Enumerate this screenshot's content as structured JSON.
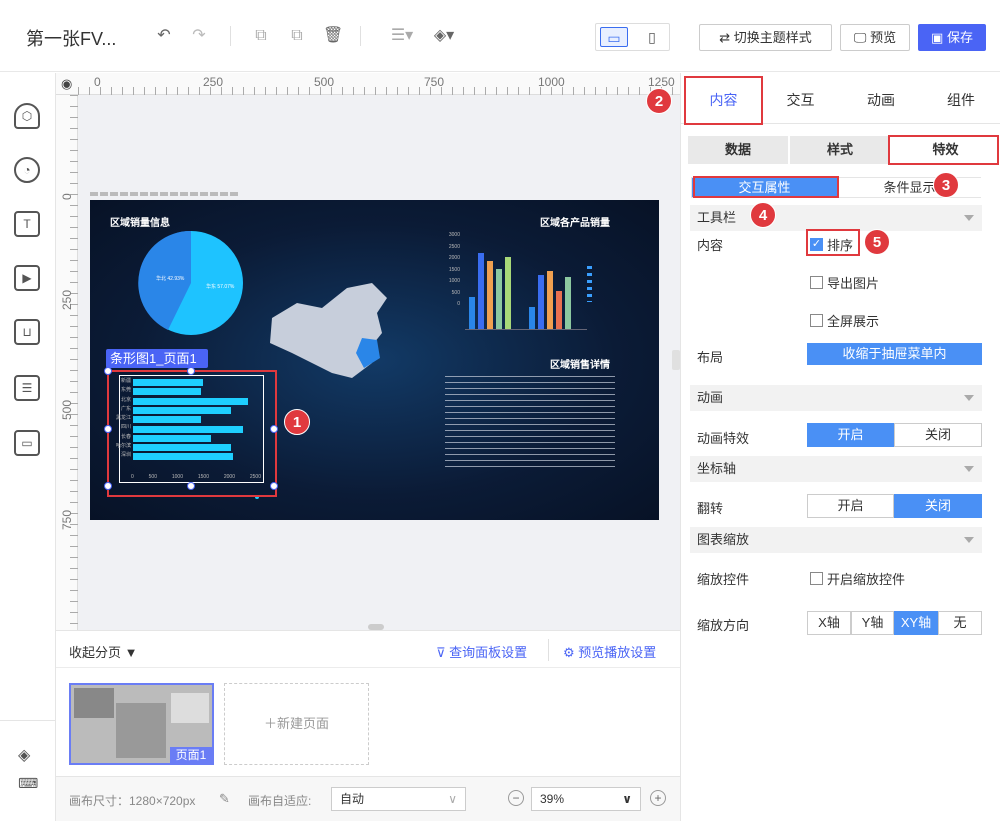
{
  "toolbar": {
    "title": "第一张FV...",
    "theme_btn": "切换主题样式",
    "preview_btn": "预览",
    "save_btn": "保存"
  },
  "panel": {
    "tabs": [
      "内容",
      "交互",
      "动画",
      "组件"
    ],
    "subtabs": [
      "数据",
      "样式",
      "特效"
    ],
    "seg_tabs": [
      "交互属性",
      "条件显示"
    ],
    "sections": {
      "toolbar": "工具栏",
      "animation": "动画",
      "axis": "坐标轴",
      "zoom": "图表缩放"
    },
    "labels": {
      "content": "内容",
      "layout": "布局",
      "anim_effect": "动画特效",
      "flip": "翻转",
      "zoom_control": "缩放控件",
      "zoom_dir": "缩放方向"
    },
    "checks": {
      "sort": "排序",
      "export": "导出图片",
      "fullscreen": "全屏展示",
      "zoom_control": "开启缩放控件"
    },
    "layout_value": "收缩于抽屉菜单内",
    "on": "开启",
    "off": "关闭",
    "zoom_dirs": [
      "X轴",
      "Y轴",
      "XY轴",
      "无"
    ]
  },
  "ruler": {
    "top": [
      "0",
      "250",
      "500",
      "750",
      "1000",
      "1250"
    ],
    "left": [
      "0",
      "250",
      "500",
      "750"
    ]
  },
  "dashboard": {
    "pie_title": "区域销量信息",
    "bar_title": "区域各产品销量",
    "table_title": "区域销售详情",
    "selected_label": "条形图1_页面1",
    "pie_labels": [
      "华北 42.93%",
      "华东 57.07%"
    ],
    "hbar_categories": [
      "新疆",
      "东莞",
      "北京",
      "广东",
      "黑龙江",
      "四川",
      "长春",
      "哈尔滨",
      "深圳"
    ],
    "hbar_values": [
      1400,
      1350,
      2300,
      1950,
      1350,
      2200,
      1550,
      1950,
      2000
    ],
    "hbar_ticks": [
      "0",
      "500",
      "1000",
      "1500",
      "2000",
      "2500"
    ],
    "vbar_ticks": [
      "3000",
      "2500",
      "2000",
      "1500",
      "1000",
      "500",
      "0"
    ]
  },
  "bottom": {
    "collapse": "收起分页",
    "query": "查询面板设置",
    "play": "预览播放设置",
    "page": "页面1",
    "new_page": "新建页面"
  },
  "footer": {
    "canvas_size": "画布尺寸：1280×720px",
    "fit_label": "画布自适应:",
    "fit_value": "自动",
    "zoom": "39%"
  },
  "annotations": [
    "1",
    "2",
    "3",
    "4",
    "5"
  ]
}
